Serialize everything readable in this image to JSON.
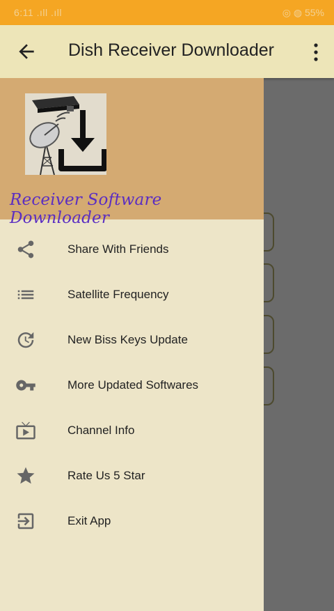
{
  "statusbar": {
    "left_text": "6:11 .ıll .ıll",
    "right_text": "◎ ◍ 55%"
  },
  "appbar": {
    "title": "Dish Receiver Downloader",
    "back_icon": "arrow-back-icon",
    "more_icon": "more-vert-icon"
  },
  "drawer": {
    "header_title": "Receiver Software Downloader",
    "items": [
      {
        "label": "Share With Friends",
        "icon": "share-icon"
      },
      {
        "label": "Satellite Frequency",
        "icon": "list-icon"
      },
      {
        "label": "New Biss Keys Update",
        "icon": "update-icon"
      },
      {
        "label": "More Updated Softwares",
        "icon": "key-icon"
      },
      {
        "label": "Channel Info",
        "icon": "tv-icon"
      },
      {
        "label": "Rate Us 5 Star",
        "icon": "star-icon"
      },
      {
        "label": "Exit App",
        "icon": "exit-icon"
      }
    ]
  },
  "colors": {
    "statusbar": "#f5a623",
    "appbar": "#ede5b8",
    "drawer_header": "#d4aa72",
    "drawer_bg": "#ede5c8",
    "header_title": "#5a2dc2",
    "scrim": "#6b6b6b"
  }
}
